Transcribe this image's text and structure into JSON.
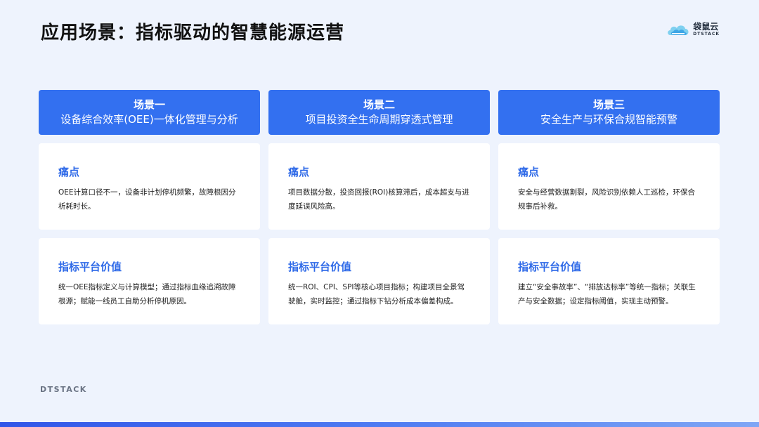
{
  "title": "应用场景：指标驱动的智慧能源运营",
  "brand": {
    "cn": "袋鼠云",
    "en": "DTSTACK",
    "footer": "DTSTACK"
  },
  "colors": {
    "accent": "#3370f0",
    "title_accent": "#2f6ae8",
    "background": "#eef3fd"
  },
  "scenarios": [
    {
      "label": "场景一",
      "name": "设备综合效率(OEE)一体化管理与分析",
      "pain_title": "痛点",
      "pain_text": "OEE计算口径不一，设备非计划停机频繁，故障根因分析耗时长。",
      "value_title": "指标平台价值",
      "value_text": "统一OEE指标定义与计算模型；通过指标血缘追溯故障根源；赋能一线员工自助分析停机原因。"
    },
    {
      "label": "场景二",
      "name": "项目投资全生命周期穿透式管理",
      "pain_title": "痛点",
      "pain_text": "项目数据分散，投资回报(ROI)核算滞后，成本超支与进度延误风险高。",
      "value_title": "指标平台价值",
      "value_text": "统一ROI、CPI、SPI等核心项目指标；构建项目全景驾驶舱，实时监控；通过指标下钻分析成本偏差构成。"
    },
    {
      "label": "场景三",
      "name": "安全生产与环保合规智能预警",
      "pain_title": "痛点",
      "pain_text": "安全与经营数据割裂，风险识别依赖人工巡检，环保合规事后补救。",
      "value_title": "指标平台价值",
      "value_text": "建立“安全事故率”、“排放达标率”等统一指标；关联生产与安全数据；设定指标阈值，实现主动预警。"
    }
  ]
}
